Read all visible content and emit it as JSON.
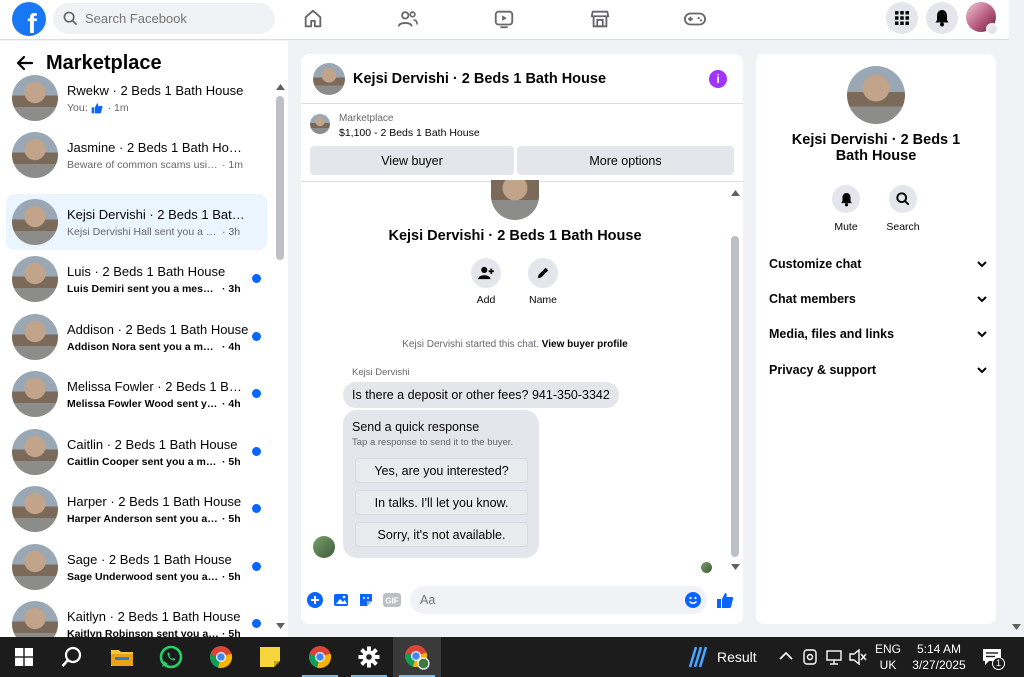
{
  "topbar": {
    "search_placeholder": "Search Facebook"
  },
  "sidebar": {
    "title": "Marketplace",
    "conversations": [
      {
        "title": "Rwekw · 2 Beds 1 Bath House",
        "snippet": "You:",
        "time": "· 1m",
        "unread": false,
        "active": false
      },
      {
        "title": "Jasmine · 2 Beds 1 Bath House",
        "snippet": "Beware of common scams using ...",
        "time": "· 1m",
        "unread": false,
        "active": false
      },
      {
        "title": "Kejsi Dervishi · 2 Beds 1 Bath H...",
        "snippet": "Kejsi Dervishi Hall sent you a mess...",
        "time": "· 3h",
        "unread": false,
        "active": true
      },
      {
        "title": "Luis · 2 Beds 1 Bath House",
        "snippet": "Luis Demiri sent you a message...",
        "time": "· 3h",
        "unread": true,
        "active": false
      },
      {
        "title": "Addison · 2 Beds 1 Bath House",
        "snippet": "Addison Nora sent you a messa...",
        "time": "· 4h",
        "unread": true,
        "active": false
      },
      {
        "title": "Melissa Fowler · 2 Beds 1 Bath...",
        "snippet": "Melissa Fowler Wood sent you ...",
        "time": "· 4h",
        "unread": true,
        "active": false
      },
      {
        "title": "Caitlin · 2 Beds 1 Bath House",
        "snippet": "Caitlin Cooper sent you a mess...",
        "time": "· 5h",
        "unread": true,
        "active": false
      },
      {
        "title": "Harper · 2 Beds 1 Bath House",
        "snippet": "Harper Anderson sent you a m...",
        "time": "· 5h",
        "unread": true,
        "active": false
      },
      {
        "title": "Sage · 2 Beds 1 Bath House",
        "snippet": "Sage Underwood sent you a m...",
        "time": "· 5h",
        "unread": true,
        "active": false
      },
      {
        "title": "Kaitlyn · 2 Beds 1 Bath House",
        "snippet": "Kaitlyn Robinson sent you a m...",
        "time": "· 5h",
        "unread": true,
        "active": false
      }
    ]
  },
  "chat": {
    "title": "Kejsi Dervishi · 2 Beds 1 Bath House",
    "marketplace_label": "Marketplace",
    "listing": "$1,100 - 2 Beds 1 Bath House",
    "view_buyer": "View buyer",
    "more_options": "More options",
    "body_title": "Kejsi Dervishi · 2 Beds 1 Bath House",
    "add_label": "Add",
    "name_label": "Name",
    "started_text": "Kejsi Dervishi started this chat.",
    "view_profile": "View buyer profile",
    "sender_name": "Kejsi Dervishi",
    "message": "Is there a deposit or other fees? 941-350-3342",
    "quick_title": "Send a quick response",
    "quick_sub": "Tap a response to send it to the buyer.",
    "quick_replies": [
      "Yes, are you interested?",
      "In talks. I'll let you know.",
      "Sorry, it's not available."
    ],
    "input_placeholder": "Aa"
  },
  "right": {
    "title": "Kejsi Dervishi · 2 Beds 1 Bath House",
    "mute": "Mute",
    "search": "Search",
    "rows": [
      "Customize chat",
      "Chat members",
      "Media, files and links",
      "Privacy & support"
    ]
  },
  "taskbar": {
    "weather": "Result",
    "lang_1": "ENG",
    "lang_2": "UK",
    "time": "5:14 AM",
    "date": "3/27/2025",
    "notif_count": "1"
  },
  "colors": {
    "accent": "#0866ff",
    "fb_blue": "#1877f2",
    "active_row": "#ebf5ff",
    "info_purple": "#a033ff"
  }
}
